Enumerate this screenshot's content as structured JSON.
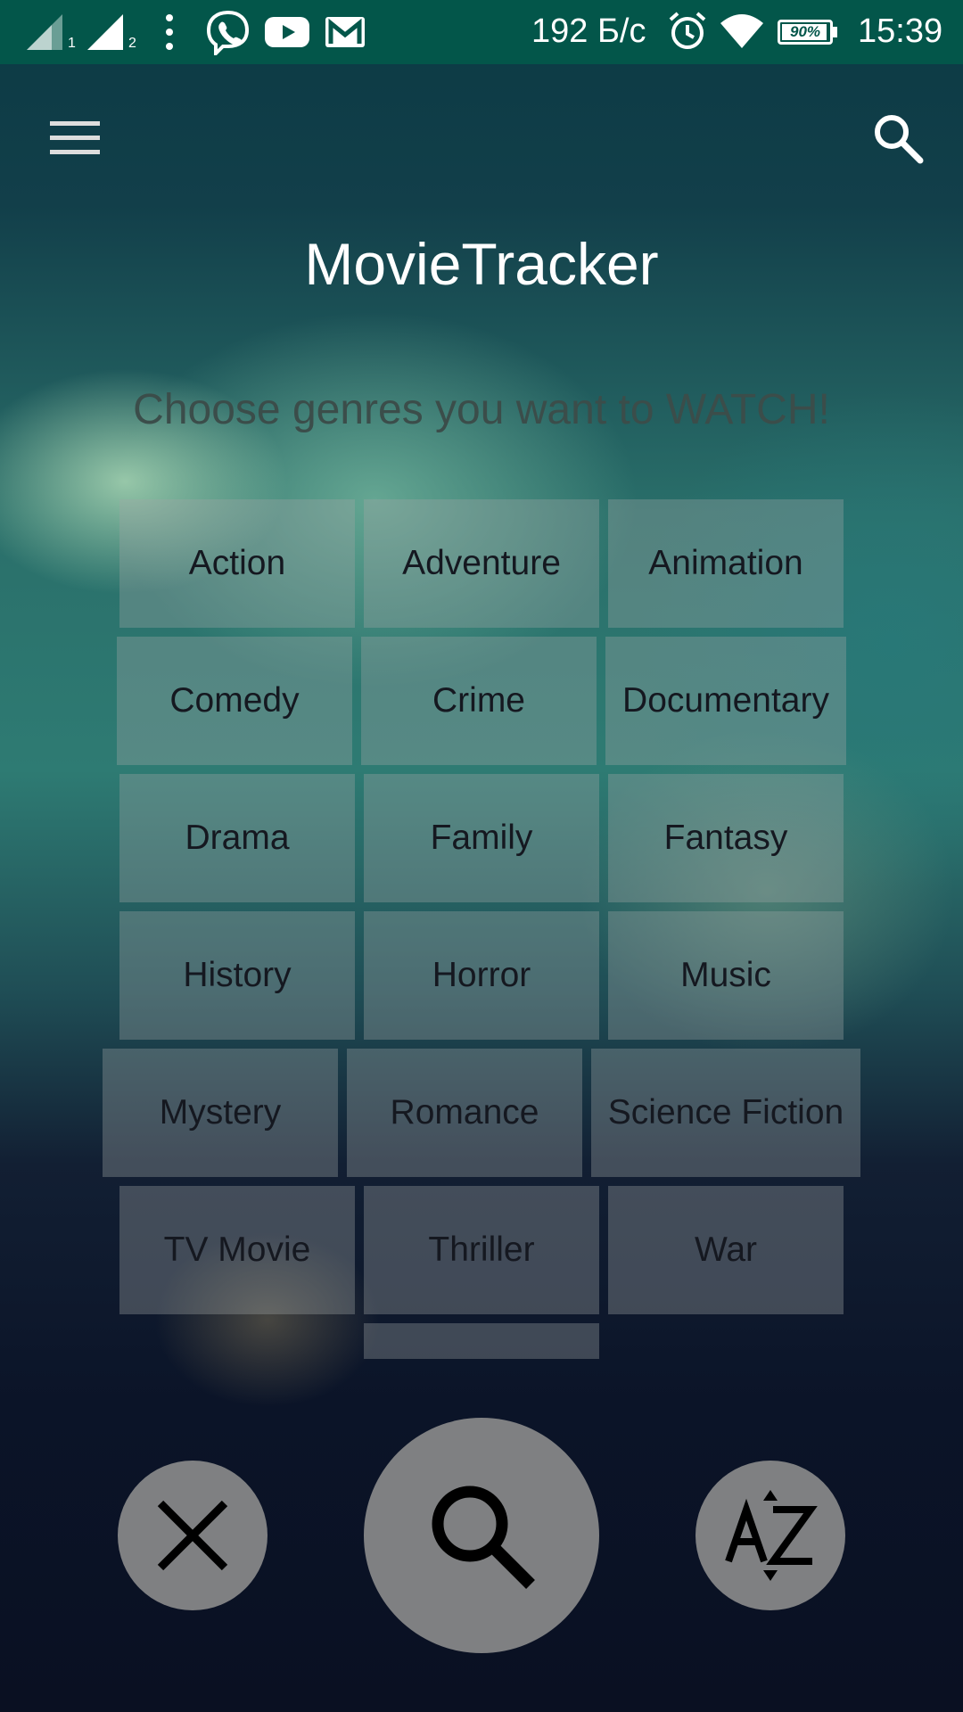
{
  "status_bar": {
    "network_speed": "192 Б/с",
    "battery": "90%",
    "time": "15:39",
    "sim1": "1",
    "sim2": "2",
    "icons": [
      "signal-sim1-icon",
      "signal-sim2-icon",
      "more-vert-icon",
      "viber-icon",
      "youtube-icon",
      "gmail-icon",
      "alarm-icon",
      "wifi-icon",
      "battery-icon"
    ]
  },
  "app": {
    "title": "MovieTracker",
    "subtitle": "Choose genres you want to WATCH!"
  },
  "genres": [
    "Action",
    "Adventure",
    "Animation",
    "Comedy",
    "Crime",
    "Documentary",
    "Drama",
    "Family",
    "Fantasy",
    "History",
    "Horror",
    "Music",
    "Mystery",
    "Romance",
    "Science Fiction",
    "TV Movie",
    "Thriller",
    "War",
    ""
  ],
  "colors": {
    "status_bar": "#03564a",
    "fab": "#7f8082",
    "chip_text": "#151820",
    "subtitle": "#3b4d4a"
  },
  "actions": {
    "clear_icon": "close-icon",
    "search_icon": "search-icon",
    "sort_icon": "sort-az-icon"
  }
}
